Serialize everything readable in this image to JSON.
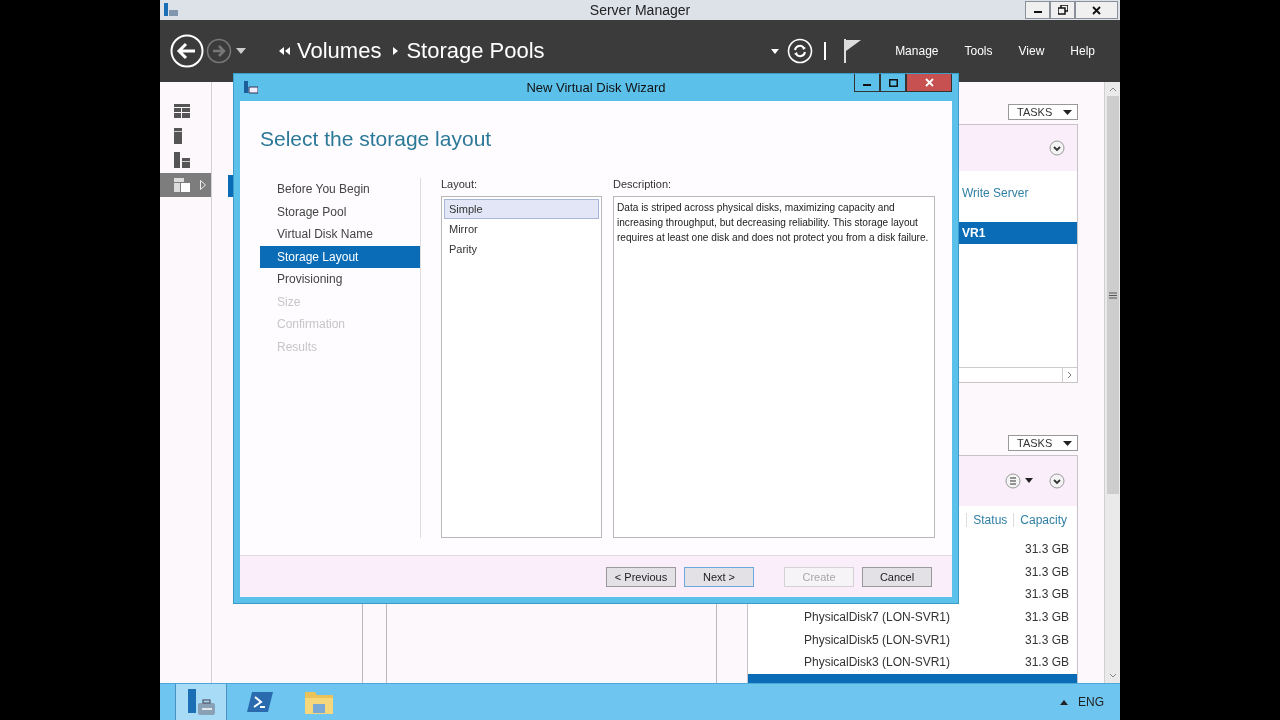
{
  "window": {
    "title": "Server Manager"
  },
  "nav": {
    "breadcrumb": [
      "Volumes",
      "Storage Pools"
    ],
    "menu": [
      "Manage",
      "Tools",
      "View",
      "Help"
    ]
  },
  "sidebar": {
    "items": [
      {
        "kind": "dashboard",
        "selected": false
      },
      {
        "kind": "server",
        "selected": false
      },
      {
        "kind": "servers",
        "selected": false
      },
      {
        "kind": "storage",
        "selected": true
      }
    ]
  },
  "pools_panel": {
    "tasks": "TASKS",
    "rows": [
      {
        "text": "Write Server",
        "selected": false
      },
      {
        "text": "VR1",
        "selected": true
      }
    ]
  },
  "disks_panel": {
    "tasks": "TASKS",
    "columns": [
      "Status",
      "Capacity"
    ],
    "rows": [
      {
        "capacity": "31.3 GB",
        "selected": false
      },
      {
        "capacity": "31.3 GB",
        "selected": false
      },
      {
        "capacity": "31.3 GB",
        "selected": false
      },
      {
        "name": "PhysicalDisk7 (LON-SVR1)",
        "capacity": "31.3 GB",
        "selected": false
      },
      {
        "name": "PhysicalDisk5 (LON-SVR1)",
        "capacity": "31.3 GB",
        "selected": false
      },
      {
        "name": "PhysicalDisk3 (LON-SVR1)",
        "capacity": "31.3 GB",
        "selected": false
      },
      {
        "selected": true
      }
    ]
  },
  "dialog": {
    "title": "New Virtual Disk Wizard",
    "heading": "Select the storage layout",
    "steps": [
      {
        "label": "Before You Begin",
        "selected": false,
        "disabled": false
      },
      {
        "label": "Storage Pool",
        "selected": false,
        "disabled": false
      },
      {
        "label": "Virtual Disk Name",
        "selected": false,
        "disabled": false
      },
      {
        "label": "Storage Layout",
        "selected": true,
        "disabled": false
      },
      {
        "label": "Provisioning",
        "selected": false,
        "disabled": false
      },
      {
        "label": "Size",
        "selected": false,
        "disabled": true
      },
      {
        "label": "Confirmation",
        "selected": false,
        "disabled": true
      },
      {
        "label": "Results",
        "selected": false,
        "disabled": true
      }
    ],
    "layout": {
      "label": "Layout:",
      "options": [
        {
          "label": "Simple",
          "selected": true
        },
        {
          "label": "Mirror",
          "selected": false
        },
        {
          "label": "Parity",
          "selected": false
        }
      ]
    },
    "description": {
      "label": "Description:",
      "text": "Data is striped across physical disks, maximizing capacity and increasing throughput, but decreasing reliability. This storage layout requires at least one disk and does not protect you from a disk failure."
    },
    "buttons": [
      {
        "label": "< Previous",
        "disabled": false,
        "default": false
      },
      {
        "label": "Next >",
        "disabled": false,
        "default": true
      },
      {
        "label": "Create",
        "disabled": true,
        "default": false
      },
      {
        "label": "Cancel",
        "disabled": false,
        "default": false
      }
    ]
  },
  "taskbar": {
    "apps": [
      {
        "kind": "server-manager",
        "selected": true
      },
      {
        "kind": "powershell",
        "selected": false
      },
      {
        "kind": "explorer",
        "selected": false
      }
    ],
    "language": "ENG"
  }
}
